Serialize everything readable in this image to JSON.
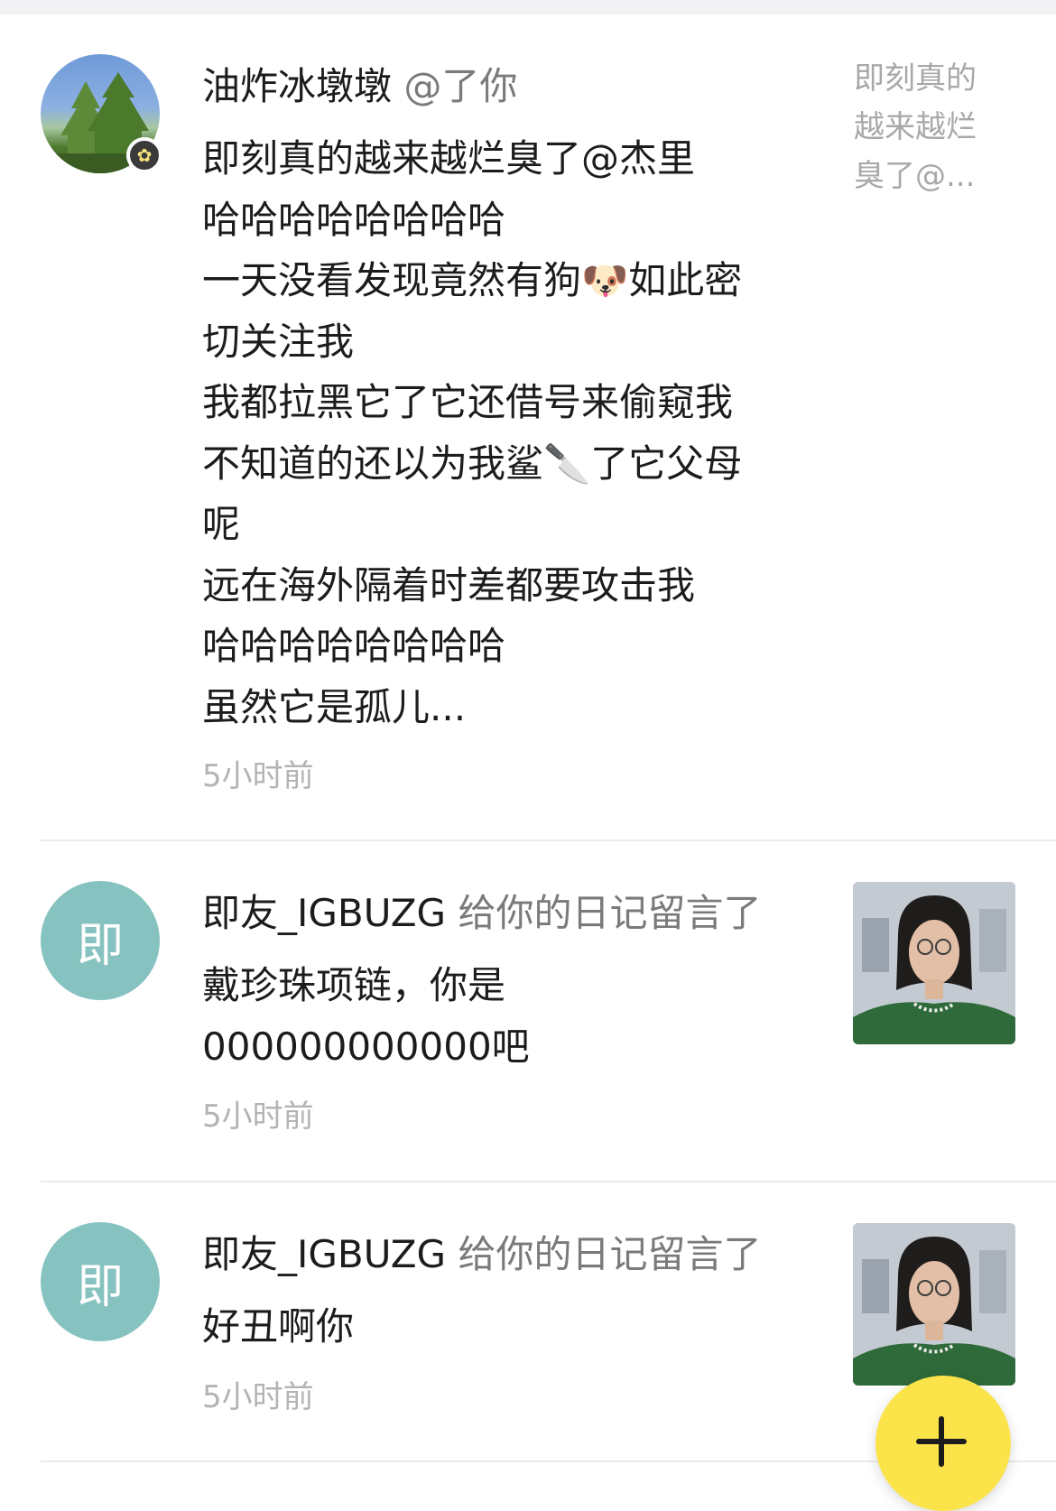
{
  "notifications": [
    {
      "sender": "油炸冰墩墩",
      "action": "@了你",
      "body_lines": [
        "即刻真的越来越烂臭了@杰里",
        "哈哈哈哈哈哈哈哈",
        "一天没看发现竟然有狗🐶如此密",
        "切关注我",
        "我都拉黑它了它还借号来偷窥我",
        "不知道的还以为我鲨🔪了它父母",
        "呢",
        "远在海外隔着时差都要攻击我",
        "哈哈哈哈哈哈哈哈",
        "虽然它是孤儿..."
      ],
      "time": "5小时前",
      "preview_lines": [
        "即刻真的",
        "越来越烂",
        "臭了@..."
      ]
    },
    {
      "sender": "即友_IGBUZG",
      "action": "给你的日记留言了",
      "avatar_letter": "即",
      "body_lines": [
        "戴珍珠项链，你是",
        "000000000000吧"
      ],
      "time": "5小时前"
    },
    {
      "sender": "即友_IGBUZG",
      "action": "给你的日记留言了",
      "avatar_letter": "即",
      "body_lines": [
        "好丑啊你"
      ],
      "time": "5小时前"
    }
  ],
  "icons": {
    "badge": "sparkle-badge-icon",
    "fab": "plus-icon"
  },
  "colors": {
    "fab": "#fbe34a",
    "letter_avatar": "#86c2bf",
    "muted_text": "#7a7a7a",
    "time_text": "#b3b3b3"
  }
}
